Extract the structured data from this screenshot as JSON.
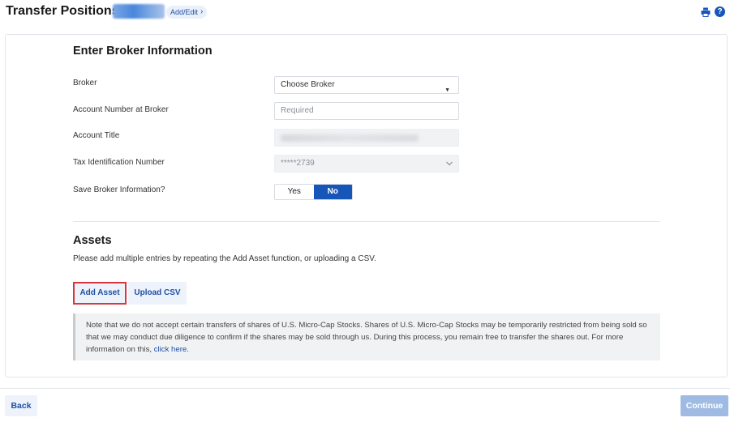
{
  "header": {
    "title": "Transfer Positions",
    "add_edit_label": "Add/Edit",
    "print_icon": "printer-icon",
    "help_icon": "help-icon",
    "help_glyph": "?"
  },
  "broker_section": {
    "title": "Enter Broker Information",
    "broker": {
      "label": "Broker",
      "value": "Choose Broker"
    },
    "account_number": {
      "label": "Account Number at Broker",
      "placeholder": "Required"
    },
    "account_title": {
      "label": "Account Title"
    },
    "tax_id": {
      "label": "Tax Identification Number",
      "value": "*****2739"
    },
    "save_broker": {
      "label": "Save Broker Information?",
      "yes_label": "Yes",
      "no_label": "No",
      "selected": "No"
    }
  },
  "assets_section": {
    "title": "Assets",
    "description": "Please add multiple entries by repeating the Add Asset function, or uploading a CSV.",
    "add_asset_label": "Add Asset",
    "upload_csv_label": "Upload CSV",
    "note_text": "Note that we do not accept certain transfers of shares of U.S. Micro-Cap Stocks. Shares of U.S. Micro-Cap Stocks may be temporarily restricted from being sold so that we may conduct due diligence to confirm if the shares may be sold through us. During this process, you remain free to transfer the shares out. For more information on this, ",
    "note_link": "click here",
    "note_end": "."
  },
  "footer": {
    "back_label": "Back",
    "continue_label": "Continue"
  },
  "colors": {
    "accent": "#1756b9",
    "highlight_border": "#d9363e",
    "continue_disabled": "#9fbbe3"
  }
}
